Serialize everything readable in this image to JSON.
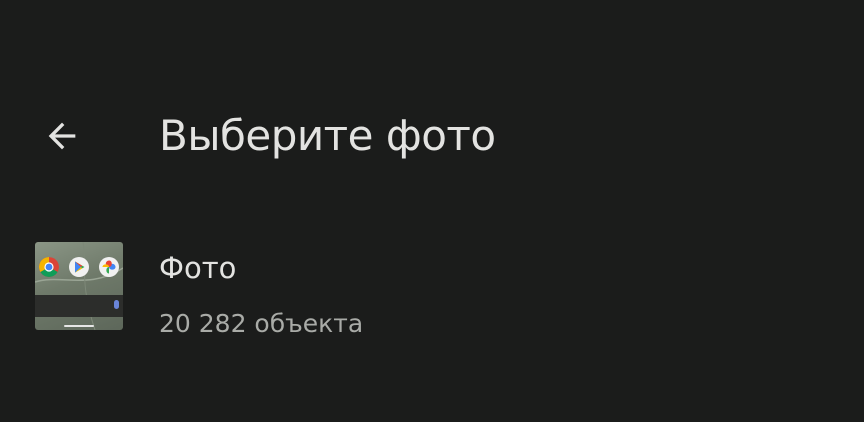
{
  "header": {
    "back_icon": "arrow-back-icon",
    "title": "Выберите фото"
  },
  "albums": [
    {
      "thumbnail_icons": [
        "chrome-icon",
        "play-store-icon",
        "google-photos-icon",
        "mic-icon"
      ],
      "name": "Фото",
      "count": "20 282 объекта"
    }
  ],
  "colors": {
    "background": "#1b1c1b",
    "title_text": "#e3e3e1",
    "secondary_text": "#a9aba7"
  }
}
